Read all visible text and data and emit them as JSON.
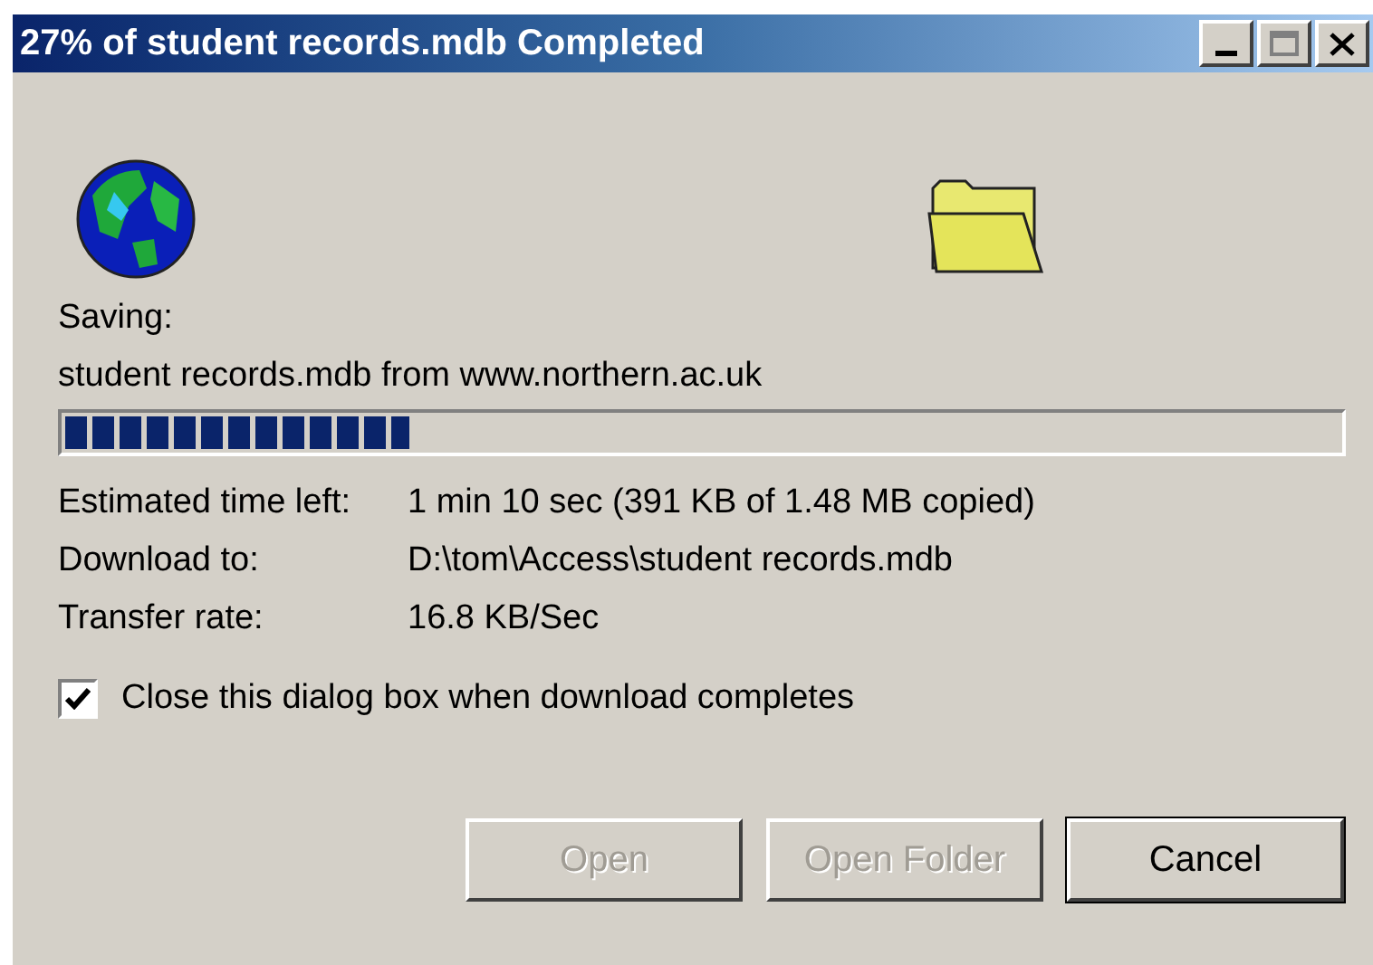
{
  "window": {
    "title": "27% of student records.mdb Completed"
  },
  "status": {
    "label": "Saving:",
    "detail": "student records.mdb from www.northern.ac.uk"
  },
  "progress": {
    "level": 0.27
  },
  "details": [
    {
      "label": "Estimated time left:",
      "value": "1 min 10 sec (391 KB of 1.48 MB copied)"
    },
    {
      "label": "Download to:",
      "value": "D:\\tom\\Access\\student records.mdb"
    },
    {
      "label": "Transfer rate:",
      "value": "16.8 KB/Sec"
    }
  ],
  "close_when_done": {
    "label": "Close this dialog box when download completes",
    "checked": true
  },
  "buttons": [
    {
      "label": "Open",
      "disabled": true,
      "default": false
    },
    {
      "label": "Open Folder",
      "disabled": true,
      "default": false
    },
    {
      "label": "Cancel",
      "disabled": false,
      "default": true
    }
  ]
}
